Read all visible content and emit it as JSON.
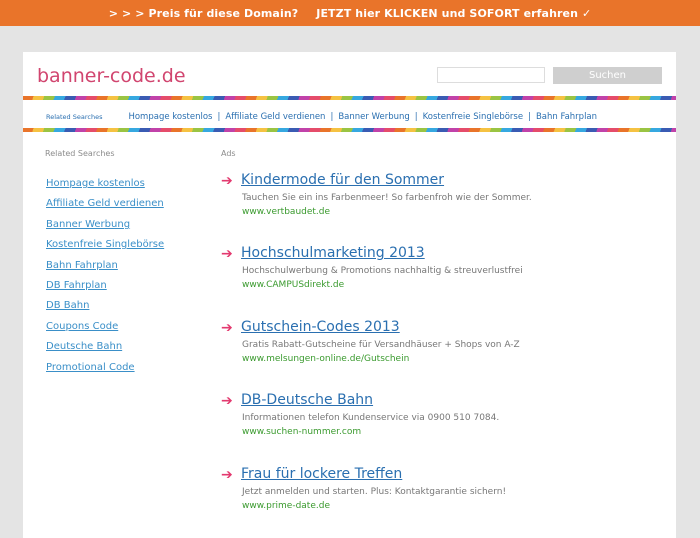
{
  "topbar": {
    "left": "> > > Preis für diese Domain?",
    "right": "JETZT hier KLICKEN und SOFORT erfahren ✓"
  },
  "header": {
    "logo": "banner-code.de",
    "search_placeholder": "",
    "search_button": "Suchen"
  },
  "related_bar": {
    "label": "Related Searches",
    "items": [
      "Hompage kostenlos",
      "Affiliate Geld verdienen",
      "Banner Werbung",
      "Kostenfreie Singlebörse",
      "Bahn Fahrplan"
    ]
  },
  "sidebar": {
    "title": "Related Searches",
    "items": [
      "Hompage kostenlos",
      "Affiliate Geld verdienen",
      "Banner Werbung",
      "Kostenfreie Singlebörse",
      "Bahn Fahrplan",
      "DB Fahrplan",
      "DB Bahn",
      "Coupons Code",
      "Deutsche Bahn",
      "Promotional Code"
    ]
  },
  "ads": {
    "title": "Ads",
    "arrow": "➔",
    "items": [
      {
        "title": "Kindermode für den Sommer",
        "desc": "Tauchen Sie ein ins Farbenmeer! So farbenfroh wie der Sommer.",
        "url": "www.vertbaudet.de"
      },
      {
        "title": "Hochschulmarketing 2013",
        "desc": "Hochschulwerbung & Promotions nachhaltig & streuverlustfrei",
        "url": "www.CAMPUSdirekt.de"
      },
      {
        "title": "Gutschein-Codes 2013",
        "desc": "Gratis Rabatt-Gutscheine für Versandhäuser + Shops von A-Z",
        "url": "www.melsungen-online.de/Gutschein"
      },
      {
        "title": "DB-Deutsche Bahn",
        "desc": "Informationen telefon Kundenservice via 0900 510 7084.",
        "url": "www.suchen-nummer.com"
      },
      {
        "title": "Frau für lockere Treffen",
        "desc": "Jetzt anmelden und starten. Plus: Kontaktgarantie sichern!",
        "url": "www.prime-date.de"
      }
    ]
  }
}
